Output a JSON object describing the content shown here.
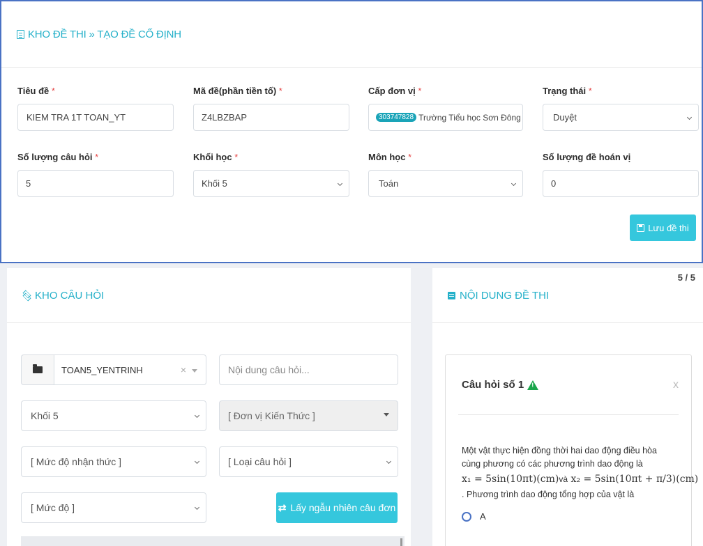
{
  "breadcrumb": "KHO ĐỀ THI » TẠO ĐỀ CỐ ĐỊNH",
  "form": {
    "title_label": "Tiêu đề",
    "title_value": "KIEM TRA 1T TOAN_YT",
    "code_label": "Mã đề(phần tiền tố)",
    "code_value": "Z4LBZBAP",
    "unit_label": "Cấp đơn vị",
    "unit_badge": "303747828",
    "unit_value": "Trường Tiểu học Sơn Đông",
    "status_label": "Trạng thái",
    "status_value": "Duyệt",
    "qcount_label": "Số lượng câu hỏi",
    "qcount_value": "5",
    "grade_label": "Khối học",
    "grade_value": "Khối 5",
    "subject_label": "Môn học",
    "subject_value": "Toán",
    "perm_label": "Số lượng đề hoán vị",
    "perm_value": "0",
    "required_mark": "*",
    "save_label": "Lưu đề thi"
  },
  "bank": {
    "title": "KHO CÂU HỎI",
    "bank_value": "TOAN5_YENTRINH",
    "clear": "×",
    "search_placeholder": "Nội dung câu hỏi...",
    "grade_value": "Khối 5",
    "knowledge_value": "[ Đơn vị Kiến Thức ]",
    "cognition_value": "[ Mức độ nhận thức ]",
    "qtype_value": "[ Loại câu hỏi ]",
    "level_value": "[ Mức độ ]",
    "random_label": "Lấy ngẫu nhiên câu đơn"
  },
  "exam": {
    "title": "NỘI DUNG ĐỀ THI",
    "count": "5 / 5",
    "question_title": "Câu hỏi số 1",
    "close": "x",
    "question_text": "Một vật thực hiện đồng thời hai dao động điều hòa cùng phương có các phương trình dao động là",
    "eq1": "x₁ = 5sin(10πt)(cm)",
    "eq_join": "và",
    "eq2": "x₂ = 5sin(10πt + π/3)(cm)",
    "question_tail": ". Phương trình dao động tổng hợp của vật là",
    "option_a": "A"
  }
}
